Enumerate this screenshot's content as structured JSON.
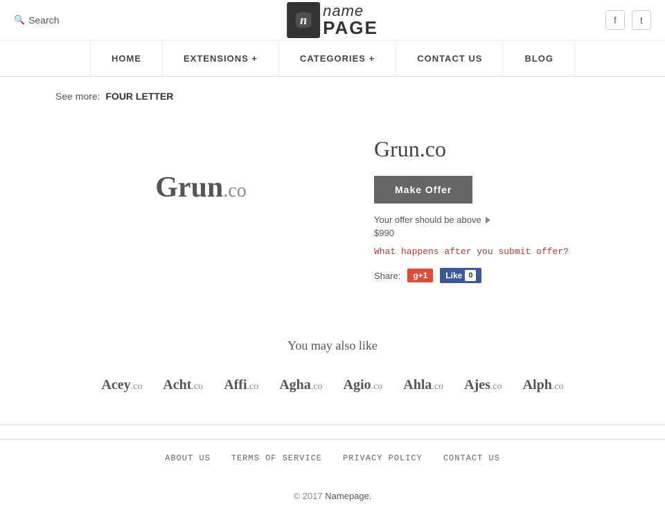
{
  "header": {
    "search_label": "Search",
    "logo_name": "name",
    "logo_page": "PAGE",
    "social": {
      "facebook_label": "f",
      "twitter_label": "t"
    }
  },
  "nav": {
    "items": [
      {
        "label": "HOME",
        "has_dropdown": false
      },
      {
        "label": "EXTENSIONS +",
        "has_dropdown": true
      },
      {
        "label": "CATEGORIES +",
        "has_dropdown": true
      },
      {
        "label": "CONTACT US",
        "has_dropdown": false
      },
      {
        "label": "BLOG",
        "has_dropdown": false
      }
    ]
  },
  "breadcrumb": {
    "prefix": "See more:",
    "link": "FOUR LETTER"
  },
  "domain": {
    "name": "Grun",
    "ext": ".co",
    "full": "Grun.co",
    "make_offer_label": "Make Offer",
    "offer_hint": "Your offer should be above",
    "offer_amount": "$990",
    "what_happens": "What happens after you submit offer?",
    "share_label": "Share:",
    "gplus_label": "g+1",
    "fb_like_label": "Like",
    "fb_count": "0"
  },
  "also_like": {
    "title": "You may also like",
    "items": [
      {
        "name": "Acey",
        "ext": ".co"
      },
      {
        "name": "Acht",
        "ext": ".co"
      },
      {
        "name": "Affi",
        "ext": ".co"
      },
      {
        "name": "Agha",
        "ext": ".co"
      },
      {
        "name": "Agio",
        "ext": ".co"
      },
      {
        "name": "Ahla",
        "ext": ".co"
      },
      {
        "name": "Ajes",
        "ext": ".co"
      },
      {
        "name": "Alph",
        "ext": ".co"
      }
    ]
  },
  "footer": {
    "links": [
      {
        "label": "ABOUT US"
      },
      {
        "label": "TERMS OF SERVICE"
      },
      {
        "label": "PRIVACY POLICY"
      },
      {
        "label": "CONTACT US"
      }
    ],
    "copyright": "© 2017",
    "brand": "Namepage."
  }
}
